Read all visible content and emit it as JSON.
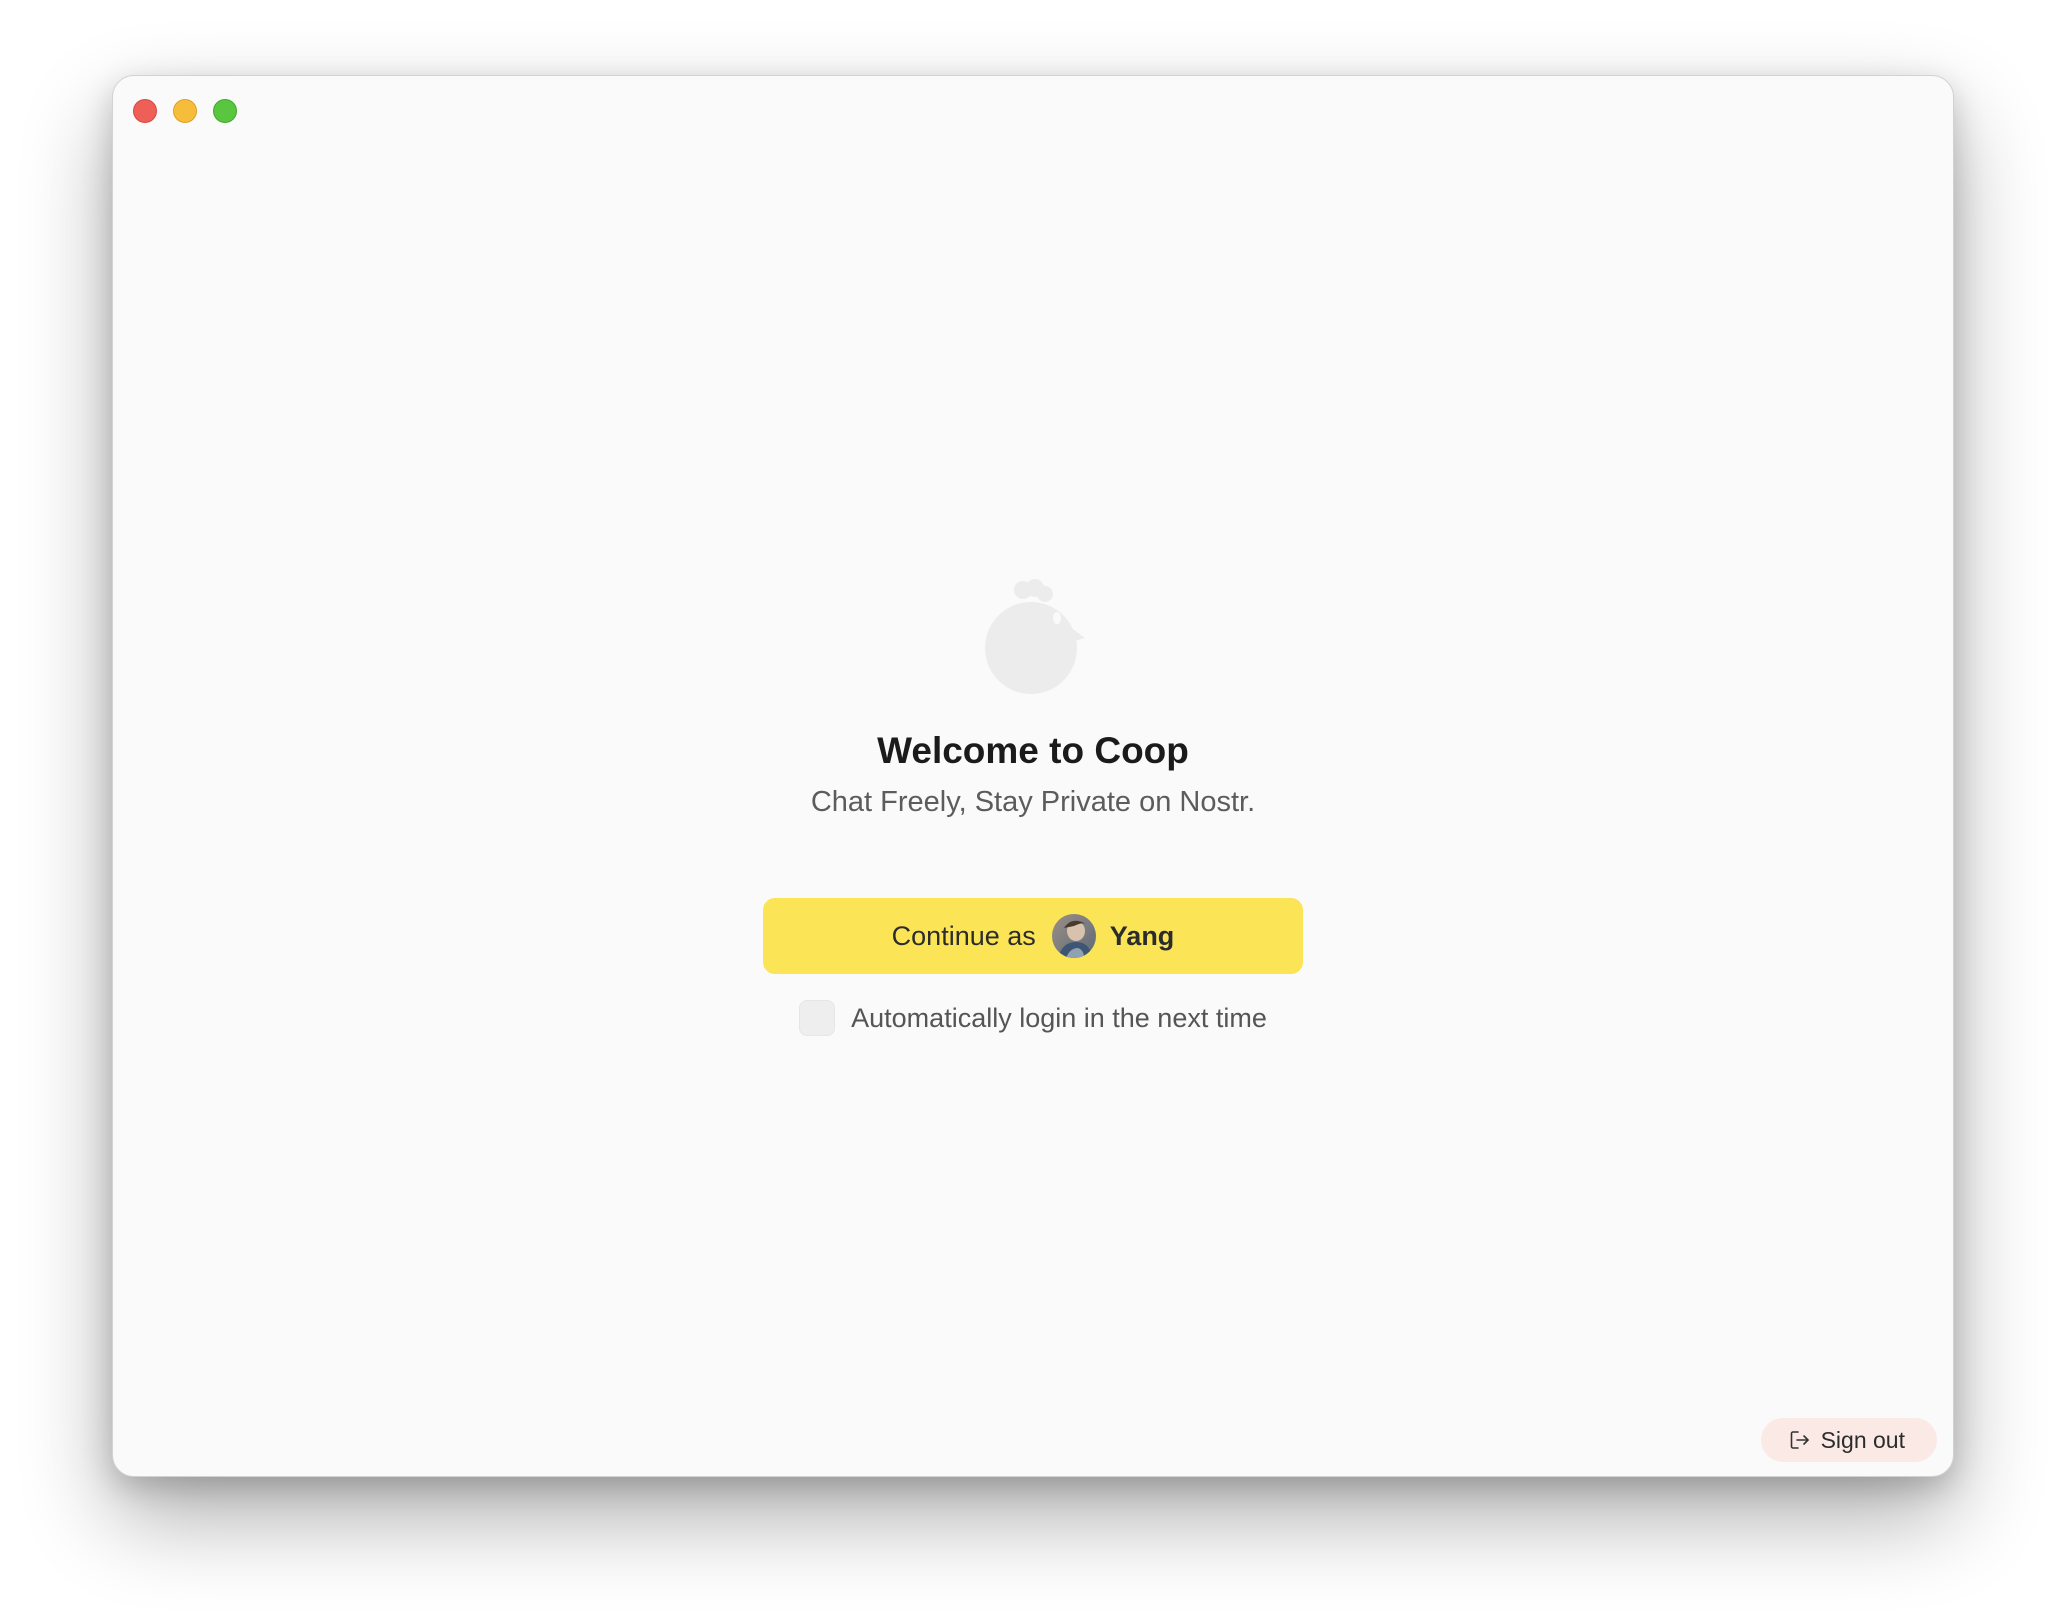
{
  "window": {
    "controls": [
      "close",
      "minimize",
      "zoom"
    ]
  },
  "onboarding": {
    "logo_icon": "chicken-logo-icon",
    "title": "Welcome to Coop",
    "subtitle": "Chat Freely, Stay Private on Nostr."
  },
  "continue_button": {
    "label": "Continue as",
    "user_name": "Yang",
    "avatar_icon": "user-avatar",
    "color": "#fbe455"
  },
  "auto_login": {
    "label": "Automatically login in the next time",
    "checked": false
  },
  "sign_out": {
    "label": "Sign out",
    "icon": "logout-icon",
    "color": "#fbe9e6"
  }
}
